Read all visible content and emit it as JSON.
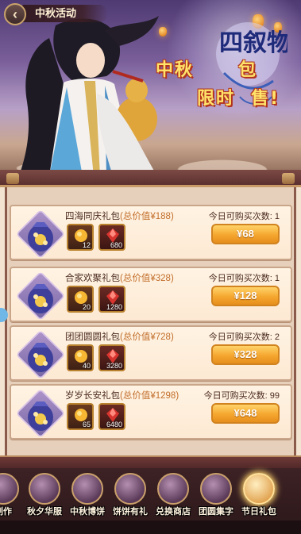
{
  "header": {
    "title": "中秋活动",
    "back_icon": "back-arrow-icon"
  },
  "banner": {
    "title_line1": "中秋",
    "title_line1_end": "包",
    "title_line2": "限时",
    "title_line2_end": "售!",
    "calligraphy_text": "四叙物"
  },
  "packs": [
    {
      "name": "四海同庆礼包",
      "total_label": "(总价值",
      "total_value": "¥188",
      "total_close": ")",
      "limit_label": "今日可购买次数:",
      "limit_count": "1",
      "items": [
        {
          "icon": "gold-ingot-icon",
          "qty": "12"
        },
        {
          "icon": "ruby-icon",
          "qty": "680"
        }
      ],
      "price": "¥68"
    },
    {
      "name": "合家欢聚礼包",
      "total_label": "(总价值",
      "total_value": "¥328",
      "total_close": ")",
      "limit_label": "今日可购买次数:",
      "limit_count": "1",
      "items": [
        {
          "icon": "gold-ingot-icon",
          "qty": "20"
        },
        {
          "icon": "ruby-icon",
          "qty": "1280"
        }
      ],
      "price": "¥128"
    },
    {
      "name": "团团圆圆礼包",
      "total_label": "(总价值",
      "total_value": "¥728",
      "total_close": ")",
      "limit_label": "今日可购买次数:",
      "limit_count": "2",
      "items": [
        {
          "icon": "gold-ingot-icon",
          "qty": "40"
        },
        {
          "icon": "ruby-icon",
          "qty": "3280"
        }
      ],
      "price": "¥328"
    },
    {
      "name": "岁岁长安礼包",
      "total_label": "(总价值",
      "total_value": "¥1298",
      "total_close": ")",
      "limit_label": "今日可购买次数:",
      "limit_count": "99",
      "items": [
        {
          "icon": "gold-ingot-icon",
          "qty": "65"
        },
        {
          "icon": "ruby-icon",
          "qty": "6480"
        }
      ],
      "price": "¥648"
    }
  ],
  "tabs": [
    {
      "label": "制作",
      "icon": "craft-icon"
    },
    {
      "label": "秋夕华服",
      "icon": "costume-icon"
    },
    {
      "label": "中秋博饼",
      "icon": "mooncake-dice-icon"
    },
    {
      "label": "饼饼有礼",
      "icon": "mooncake-gift-icon"
    },
    {
      "label": "兑换商店",
      "icon": "exchange-shop-icon"
    },
    {
      "label": "团圆集字",
      "icon": "collect-words-icon"
    },
    {
      "label": "节日礼包",
      "icon": "festival-pack-icon",
      "active": true
    }
  ],
  "colors": {
    "accent": "#f5a72f",
    "total_value": "#c26e2b",
    "panel": "#f3e4d2"
  }
}
